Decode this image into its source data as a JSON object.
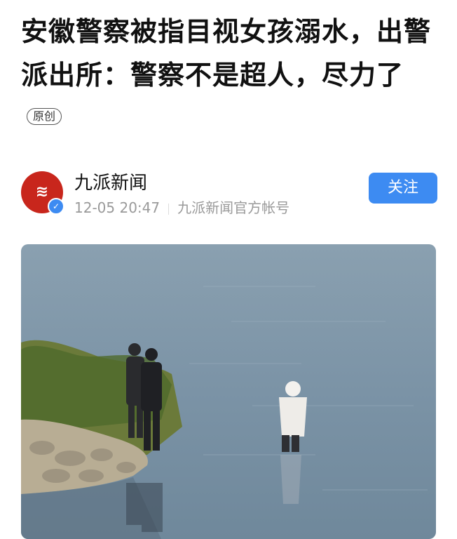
{
  "article": {
    "title": "安徽警察被指目视女孩溺水，出警派出所：警察不是超人，尽力了",
    "badge": "原创"
  },
  "author": {
    "name": "九派新闻",
    "timestamp": "12-05 20:47",
    "account_type": "九派新闻官方帐号",
    "follow_label": "关注",
    "avatar_icon": "jiupai-logo-icon",
    "verified_icon": "verified-badge-icon"
  },
  "photo": {
    "icon": "news-photo"
  },
  "colors": {
    "accent": "#3d8bf2",
    "avatar_bg": "#c8261c",
    "meta_text": "#9a9a9a"
  }
}
